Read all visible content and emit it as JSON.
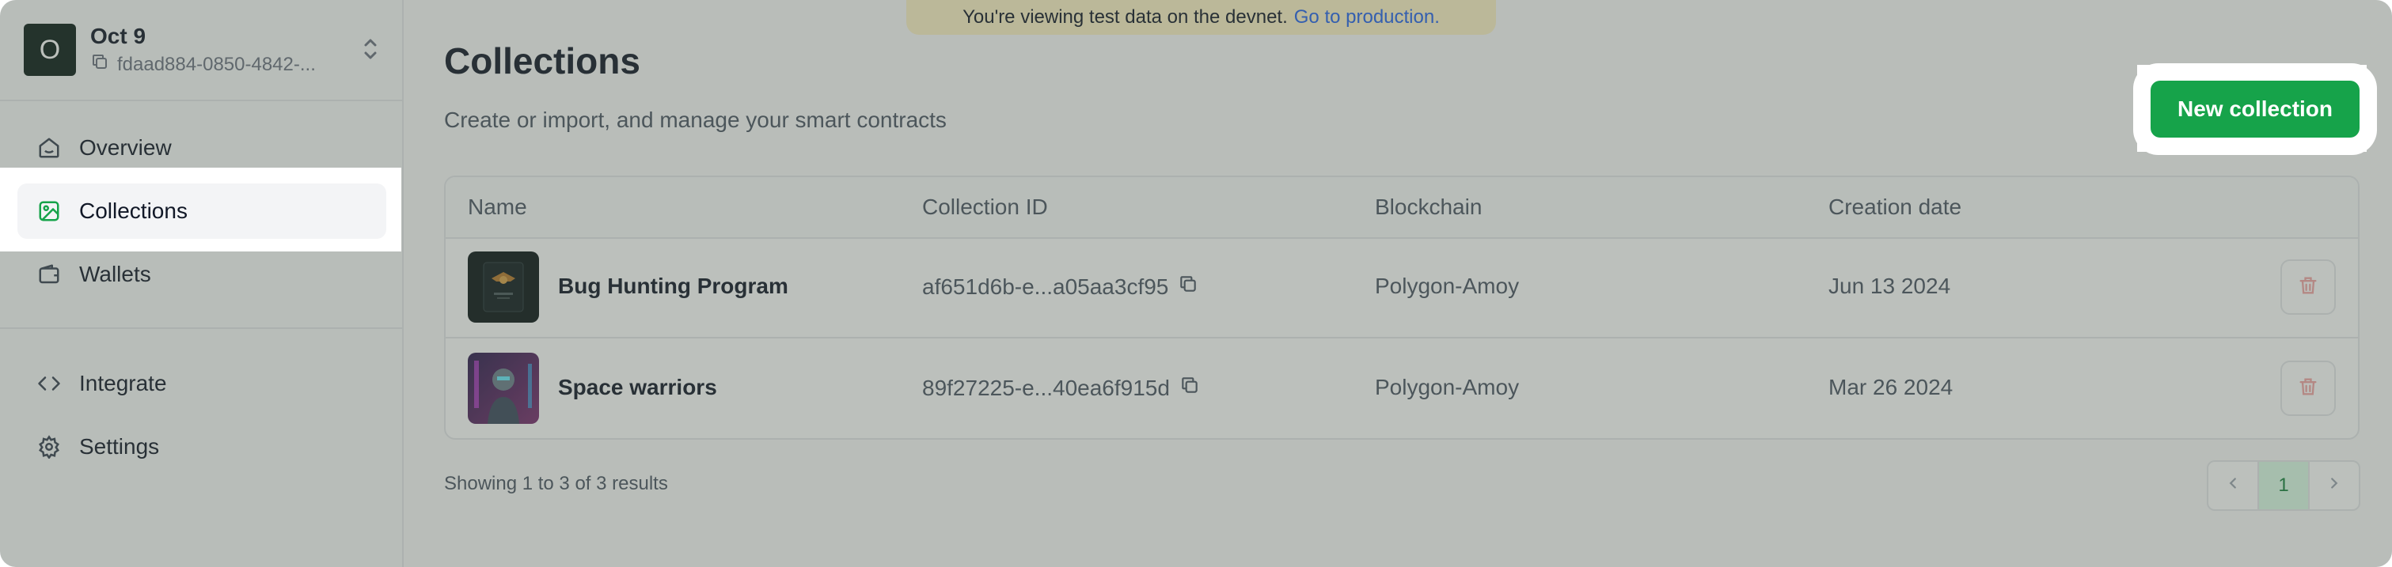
{
  "banner": {
    "text": "You're viewing test data on the devnet.",
    "link": "Go to production."
  },
  "project": {
    "avatar_letter": "O",
    "name": "Oct 9",
    "id": "fdaad884-0850-4842-..."
  },
  "sidebar": {
    "items": [
      {
        "label": "Overview",
        "icon": "home-icon"
      },
      {
        "label": "Collections",
        "icon": "image-icon"
      },
      {
        "label": "Wallets",
        "icon": "wallet-icon"
      },
      {
        "label": "Integrate",
        "icon": "code-icon"
      },
      {
        "label": "Settings",
        "icon": "gear-icon"
      }
    ]
  },
  "page": {
    "title": "Collections",
    "subtitle": "Create or import, and manage your smart contracts",
    "new_button": "New collection"
  },
  "table": {
    "headers": [
      "Name",
      "Collection ID",
      "Blockchain",
      "Creation date"
    ],
    "rows": [
      {
        "name": "Bug Hunting Program",
        "id": "af651d6b-e...a05aa3cf95",
        "chain": "Polygon-Amoy",
        "date": "Jun 13 2024"
      },
      {
        "name": "Space warriors",
        "id": "89f27225-e...40ea6f915d",
        "chain": "Polygon-Amoy",
        "date": "Mar 26 2024"
      }
    ]
  },
  "footer": {
    "showing": "Showing 1 to 3 of 3 results",
    "page": "1"
  },
  "colors": {
    "accent": "#16a34a",
    "banner": "#fef3c7",
    "link": "#2563eb"
  }
}
